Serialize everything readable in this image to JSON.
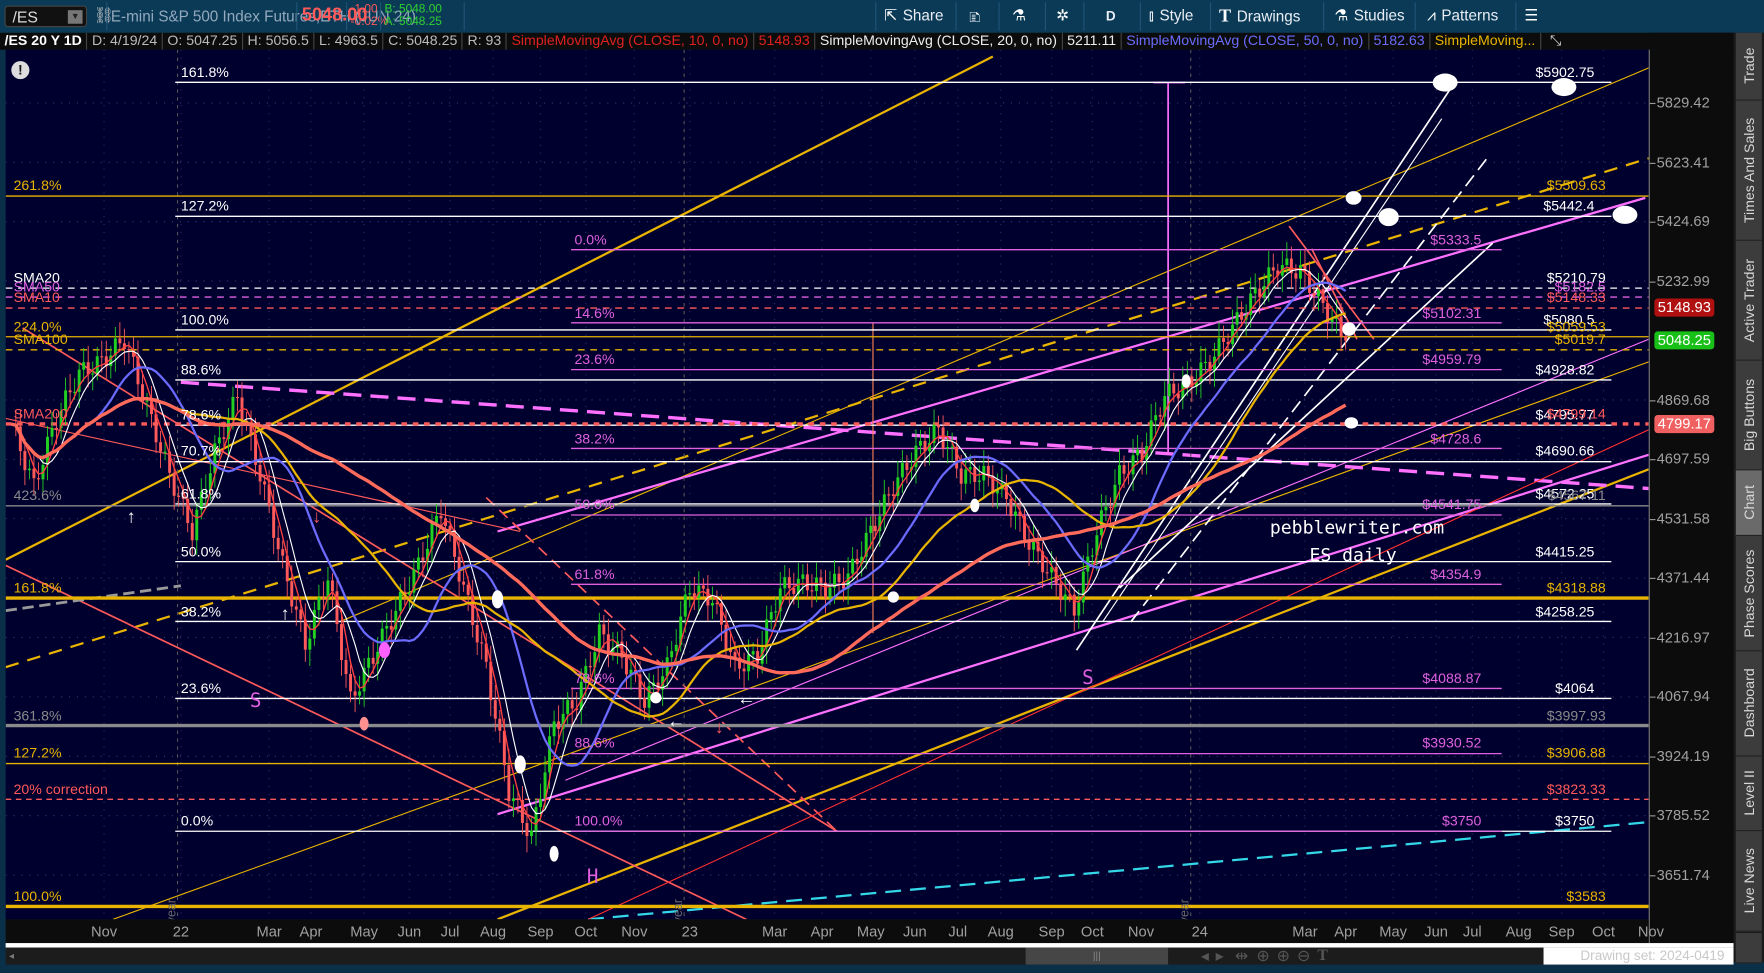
{
  "toolbar": {
    "symbol": "/ES",
    "description": "E-mini S&P 500 Index Futures,ETH (JUN 24)",
    "last_price": "5048.00",
    "change": "-1.00",
    "change_pct": "-0.02%",
    "bid": "B: 5048.00",
    "ask": "A: 5048.25",
    "share_label": "Share",
    "aggregation_label": "D",
    "style_label": "Style",
    "drawings_label": "Drawings",
    "studies_label": "Studies",
    "patterns_label": "Patterns"
  },
  "legend": {
    "chart_id": "/ES 20 Y 1D",
    "date": "D: 4/19/24",
    "open": "O: 5047.25",
    "high": "H: 5056.5",
    "low": "L: 4963.5",
    "close": "C: 5048.25",
    "range": "R: 93",
    "sma10_name": "SimpleMovingAvg (CLOSE, 10, 0, no)",
    "sma10_value": "5148.93",
    "sma20_name": "SimpleMovingAvg (CLOSE, 20, 0, no)",
    "sma20_value": "5211.11",
    "sma50_name": "SimpleMovingAvg (CLOSE, 50, 0, no)",
    "sma50_value": "5182.63",
    "sma_more": "SimpleMoving..."
  },
  "colors": {
    "up": "#22d022",
    "down": "#ff5a5a",
    "sma10": "#ff4040",
    "sma20": "#ffffff",
    "sma50": "#6b6bff",
    "sma100": "#e8b400",
    "sma200": "#ff6a5a",
    "badge_sma10": "#b01010",
    "badge_last": "#18c018",
    "badge_sma200": "#f06060"
  },
  "price_axis": {
    "ticks": [
      "5829.42",
      "5623.41",
      "5424.69",
      "5232.99",
      "4869.68",
      "4697.59",
      "4531.58",
      "4371.44",
      "4216.97",
      "4067.94",
      "3924.19",
      "3785.52",
      "3651.74"
    ],
    "badges": [
      {
        "value": "5148.93",
        "color": "#b01010"
      },
      {
        "value": "5048.25",
        "color": "#18c018"
      },
      {
        "value": "4799.17",
        "color": "#f06060"
      }
    ]
  },
  "time_axis": [
    "Nov",
    "22",
    "Mar",
    "Apr",
    "May",
    "Jun",
    "Jul",
    "Aug",
    "Sep",
    "Oct",
    "Nov",
    "23",
    "Mar",
    "Apr",
    "May",
    "Jun",
    "Jul",
    "Aug",
    "Sep",
    "Oct",
    "Nov",
    "24",
    "Mar",
    "Apr",
    "May",
    "Jun",
    "Jul",
    "Aug",
    "Sep",
    "Oct",
    "Nov"
  ],
  "year_markers": [
    "2021 year",
    "2022 year",
    "2023 year"
  ],
  "fib_sets": [
    {
      "name": "white",
      "color": "#ffffff",
      "levels": [
        {
          "pct": "161.8%",
          "price": 5902.75,
          "label": "$5902.75"
        },
        {
          "pct": "127.2%",
          "price": 5442.4,
          "label": "$5442.4"
        },
        {
          "pct": "100.0%",
          "price": 5080.5,
          "label": "$5080.5"
        },
        {
          "pct": "88.6%",
          "price": 4928.82,
          "label": "$4928.82"
        },
        {
          "pct": "78.6%",
          "price": 4795.77,
          "label": "$4795.77"
        },
        {
          "pct": "70.7%",
          "price": 4690.66,
          "label": "$4690.66"
        },
        {
          "pct": "61.8%",
          "price": 4572.25,
          "label": "$4572.25"
        },
        {
          "pct": "50.0%",
          "price": 4415.25,
          "label": "$4415.25"
        },
        {
          "pct": "38.2%",
          "price": 4258.25,
          "label": "$4258.25"
        },
        {
          "pct": "23.6%",
          "price": 4064,
          "label": "$4064"
        },
        {
          "pct": "0.0%",
          "price": 3750,
          "label": "$3750"
        }
      ]
    },
    {
      "name": "magenta",
      "color": "#e060e0",
      "levels": [
        {
          "pct": "0.0%",
          "price": 5333.5,
          "label": "$5333.5"
        },
        {
          "pct": "14.6%",
          "price": 5102.31,
          "label": "$5102.31"
        },
        {
          "pct": "23.6%",
          "price": 4959.79,
          "label": "$4959.79"
        },
        {
          "pct": "38.2%",
          "price": 4728.6,
          "label": "$4728.6"
        },
        {
          "pct": "50.0%",
          "price": 4541.75,
          "label": "$4541.75"
        },
        {
          "pct": "61.8%",
          "price": 4354.9,
          "label": "$4354.9"
        },
        {
          "pct": "78.6%",
          "price": 4088.87,
          "label": "$4088.87"
        },
        {
          "pct": "88.6%",
          "price": 3930.52,
          "label": "$3930.52"
        },
        {
          "pct": "100.0%",
          "price": 3750,
          "label": "$3750"
        }
      ]
    },
    {
      "name": "gold",
      "color": "#e8b400",
      "levels": [
        {
          "pct": "261.8%",
          "price": 5509.63,
          "label": "$5509.63"
        },
        {
          "pct": "224.0%",
          "price": 5059.53,
          "label": "$5059.53"
        },
        {
          "pct": "161.8%",
          "price": 4318.88,
          "label": "$4318.88"
        },
        {
          "pct": "127.2%",
          "price": 3906.88,
          "label": "$3906.88"
        },
        {
          "pct": "100.0%",
          "price": 3583,
          "label": "$3583"
        }
      ]
    },
    {
      "name": "gray",
      "color": "#8a8a8a",
      "levels": [
        {
          "pct": "423.6%",
          "price": 4567.11,
          "label": "$4567.11"
        },
        {
          "pct": "361.8%",
          "price": 3997.93,
          "label": "$3997.93"
        }
      ]
    },
    {
      "name": "red",
      "color": "#ff5a5a",
      "levels": [
        {
          "pct": "20% correction",
          "price": 3823.33,
          "label": "$3823.33"
        }
      ]
    }
  ],
  "sma_levels": [
    {
      "name": "SMA20",
      "price": 5210.79,
      "label": "$5210.79",
      "color": "#ffffff",
      "dash": "6,5"
    },
    {
      "name": "SMA50",
      "price": 5182.5,
      "label": "$5182.5",
      "color": "#e060e0",
      "dash": "6,5"
    },
    {
      "name": "SMA10",
      "price": 5148.33,
      "label": "$5148.33",
      "color": "#ff5a5a",
      "dash": "6,5"
    },
    {
      "name": "SMA100",
      "price": 5019.7,
      "label": "$5019.7",
      "color": "#e8b400",
      "dash": "6,5"
    },
    {
      "name": "SMA200",
      "price": 4799.14,
      "label": "$4799.14",
      "color": "#ff5a5a",
      "dash": "5,5"
    }
  ],
  "annotations": {
    "watermark_line1": "pebblewriter.com",
    "watermark_line2": "ES daily",
    "pattern_left_shoulder": "S",
    "pattern_head": "H",
    "pattern_right_shoulder": "S"
  },
  "close_samples": [
    4799,
    4622,
    4815,
    4949,
    4984,
    5052,
    4848,
    4654,
    4497,
    4718,
    4882,
    4654,
    4405,
    4199,
    4375,
    4058,
    4170,
    4286,
    4405,
    4559,
    4345,
    4142,
    3842,
    3737,
    4003,
    4058,
    4228,
    4170,
    4058,
    4142,
    4345,
    4316,
    4142,
    4170,
    4345,
    4360,
    4345,
    4375,
    4497,
    4622,
    4718,
    4783,
    4654,
    4654,
    4590,
    4466,
    4375,
    4286,
    4497,
    4654,
    4718,
    4882,
    4915,
    4984,
    5087,
    5192,
    5282,
    5264,
    5157,
    5048
  ],
  "sidebar_tabs": [
    "Trade",
    "Times And Sales",
    "Active Trader",
    "Big Buttons",
    "Chart",
    "Phase Scores",
    "Dashboard",
    "Level II",
    "Live News"
  ],
  "active_tab": "Chart",
  "bottom": {
    "drawing_set": "Drawing set: 2024-0419"
  }
}
